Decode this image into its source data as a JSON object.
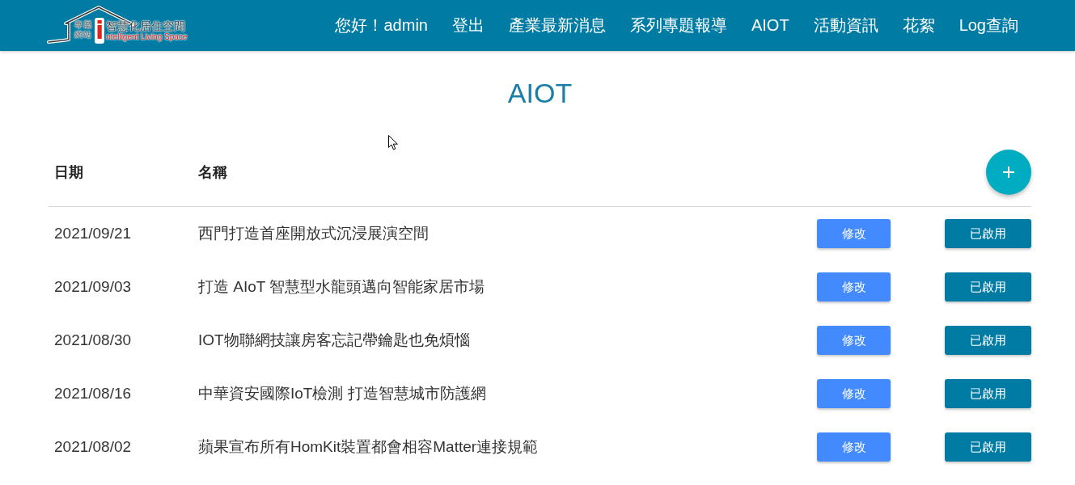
{
  "header": {
    "logo": {
      "tag_lines": [
        "專屬",
        "網站"
      ],
      "mark": "i",
      "title": "智慧化居住空間",
      "subtitle": "ntelligent Living Space"
    },
    "nav": [
      {
        "label": "您好！admin"
      },
      {
        "label": "登出"
      },
      {
        "label": "產業最新消息"
      },
      {
        "label": "系列專題報導"
      },
      {
        "label": "AIOT"
      },
      {
        "label": "活動資訊"
      },
      {
        "label": "花絮"
      },
      {
        "label": "Log查詢"
      }
    ]
  },
  "page_title": "AIOT",
  "table": {
    "columns": [
      "日期",
      "名稱"
    ],
    "rows": [
      {
        "date": "2021/09/21",
        "name": "西門打造首座開放式沉浸展演空間",
        "edit": "修改",
        "status": "已啟用"
      },
      {
        "date": "2021/09/03",
        "name": "打造 AIoT 智慧型水龍頭邁向智能家居市場",
        "edit": "修改",
        "status": "已啟用"
      },
      {
        "date": "2021/08/30",
        "name": "IOT物聯網技讓房客忘記帶鑰匙也免煩惱",
        "edit": "修改",
        "status": "已啟用"
      },
      {
        "date": "2021/08/16",
        "name": "中華資安國際IoT檢測 打造智慧城市防護網",
        "edit": "修改",
        "status": "已啟用"
      },
      {
        "date": "2021/08/02",
        "name": "蘋果宣布所有HomKit裝置都會相容Matter連接規範",
        "edit": "修改",
        "status": "已啟用"
      }
    ]
  }
}
